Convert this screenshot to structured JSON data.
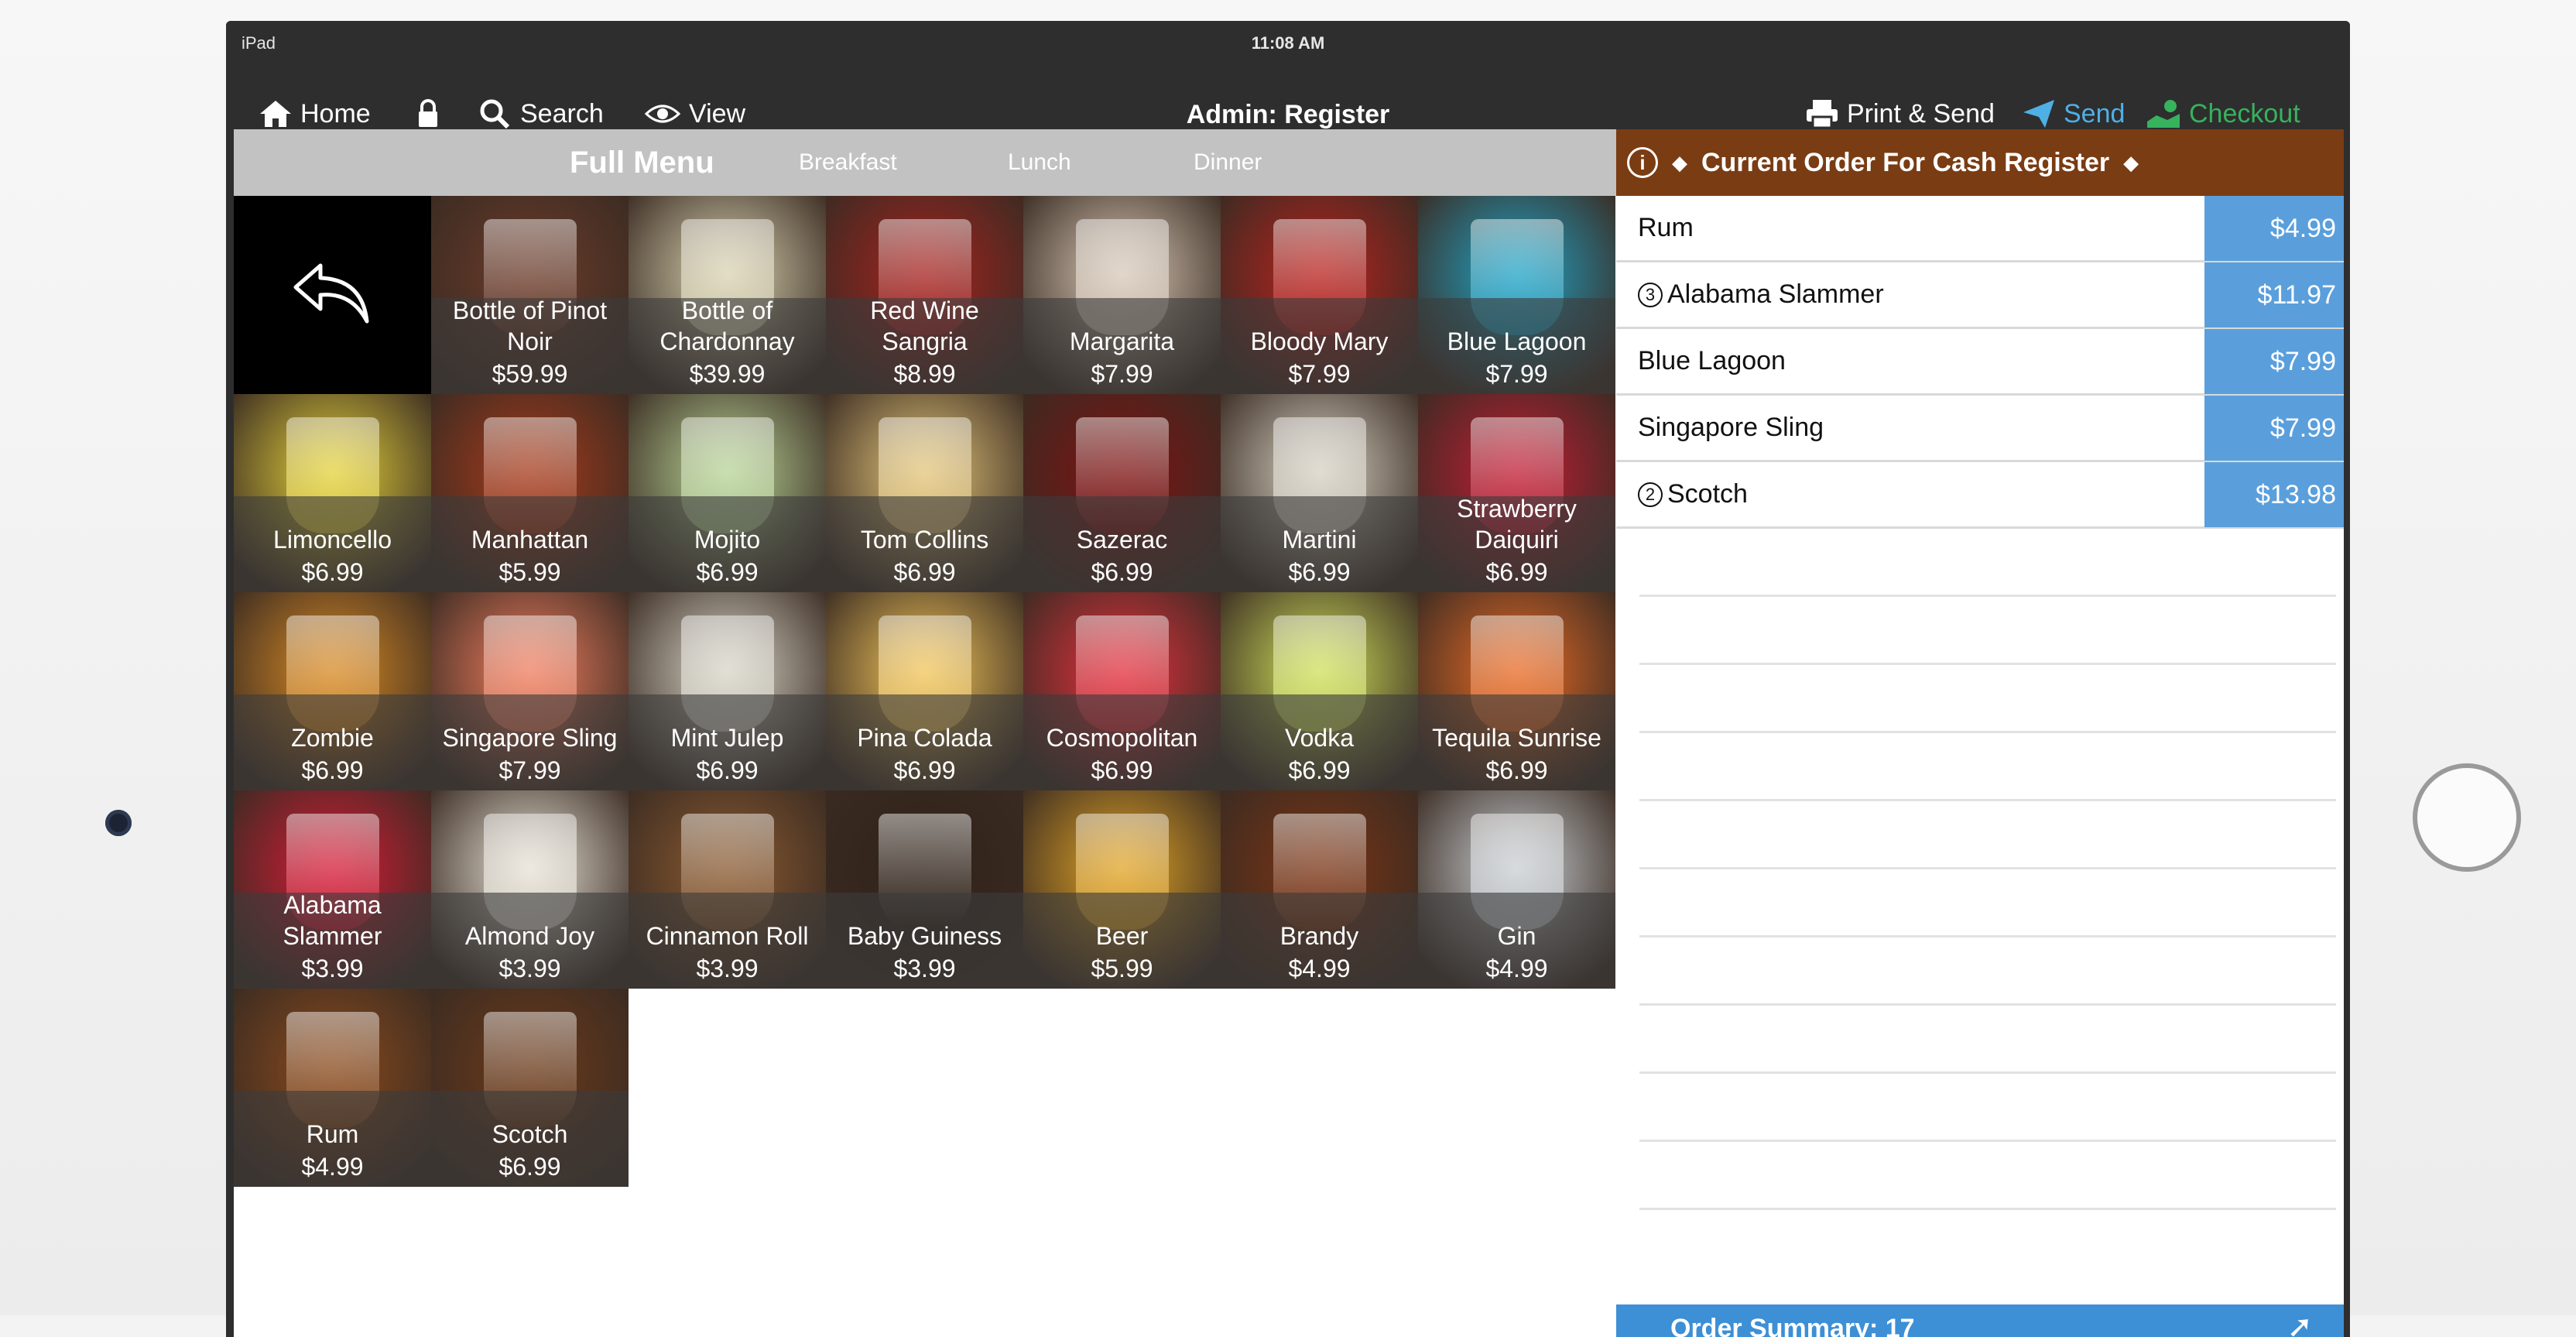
{
  "status_bar": {
    "carrier": "iPad",
    "time": "11:08 AM"
  },
  "nav": {
    "home": "Home",
    "search": "Search",
    "view": "View",
    "title": "Admin: Register",
    "print_send": "Print & Send",
    "send": "Send",
    "checkout": "Checkout"
  },
  "menu_tabs": [
    "Full Menu",
    "Breakfast",
    "Lunch",
    "Dinner"
  ],
  "menu_items": [
    {
      "name": "Bottle of Pinot Noir",
      "price": "$59.99",
      "color": "#6b3b2a"
    },
    {
      "name": "Bottle of Chardonnay",
      "price": "$39.99",
      "color": "#d9d3b2"
    },
    {
      "name": "Red Wine Sangria",
      "price": "$8.99",
      "color": "#a6221f"
    },
    {
      "name": "Margarita",
      "price": "$7.99",
      "color": "#d8c9b8"
    },
    {
      "name": "Bloody Mary",
      "price": "$7.99",
      "color": "#b9221e"
    },
    {
      "name": "Blue Lagoon",
      "price": "$7.99",
      "color": "#21a4c7"
    },
    {
      "name": "Limoncello",
      "price": "$6.99",
      "color": "#e4d23b"
    },
    {
      "name": "Manhattan",
      "price": "$5.99",
      "color": "#a63a1b"
    },
    {
      "name": "Mojito",
      "price": "$6.99",
      "color": "#b8d497"
    },
    {
      "name": "Tom Collins",
      "price": "$6.99",
      "color": "#e3c57a"
    },
    {
      "name": "Sazerac",
      "price": "$6.99",
      "color": "#7e1212"
    },
    {
      "name": "Martini",
      "price": "$6.99",
      "color": "#d6d1c3"
    },
    {
      "name": "Strawberry Daiquiri",
      "price": "$6.99",
      "color": "#c11d34"
    },
    {
      "name": "Zombie",
      "price": "$6.99",
      "color": "#d88a24"
    },
    {
      "name": "Singapore Sling",
      "price": "$7.99",
      "color": "#ef7d5e"
    },
    {
      "name": "Mint Julep",
      "price": "$6.99",
      "color": "#d8d5c8"
    },
    {
      "name": "Pina Colada",
      "price": "$6.99",
      "color": "#f1c55a"
    },
    {
      "name": "Cosmopolitan",
      "price": "$6.99",
      "color": "#e3303d"
    },
    {
      "name": "Vodka",
      "price": "$6.99",
      "color": "#cfe05b"
    },
    {
      "name": "Tequila Sunrise",
      "price": "$6.99",
      "color": "#e86b26"
    },
    {
      "name": "Alabama Slammer",
      "price": "$3.99",
      "color": "#d61b36"
    },
    {
      "name": "Almond Joy",
      "price": "$3.99",
      "color": "#e7e2d6"
    },
    {
      "name": "Cinnamon Roll",
      "price": "$3.99",
      "color": "#8a5a30"
    },
    {
      "name": "Baby Guiness",
      "price": "$3.99",
      "color": "#2f2218"
    },
    {
      "name": "Beer",
      "price": "$5.99",
      "color": "#e1a425"
    },
    {
      "name": "Brandy",
      "price": "$4.99",
      "color": "#7a3414"
    },
    {
      "name": "Gin",
      "price": "$4.99",
      "color": "#c9cfd3"
    },
    {
      "name": "Rum",
      "price": "$4.99",
      "color": "#8a4a1c"
    },
    {
      "name": "Scotch",
      "price": "$6.99",
      "color": "#6b3a1a"
    }
  ],
  "order": {
    "title": "Current Order For Cash Register",
    "items": [
      {
        "qty": "",
        "name": "Rum",
        "amount": "$4.99"
      },
      {
        "qty": "3",
        "name": "Alabama Slammer",
        "amount": "$11.97"
      },
      {
        "qty": "",
        "name": "Blue Lagoon",
        "amount": "$7.99"
      },
      {
        "qty": "",
        "name": "Singapore Sling",
        "amount": "$7.99"
      },
      {
        "qty": "2",
        "name": "Scotch",
        "amount": "$13.98"
      }
    ],
    "summary_label": "Order Summary: 17"
  },
  "colors": {
    "nav_bg": "#2e2e2e",
    "send": "#4fb0e6",
    "checkout": "#37b25d",
    "order_header": "#7a3c13",
    "amount_bg": "#5a9fdc"
  }
}
